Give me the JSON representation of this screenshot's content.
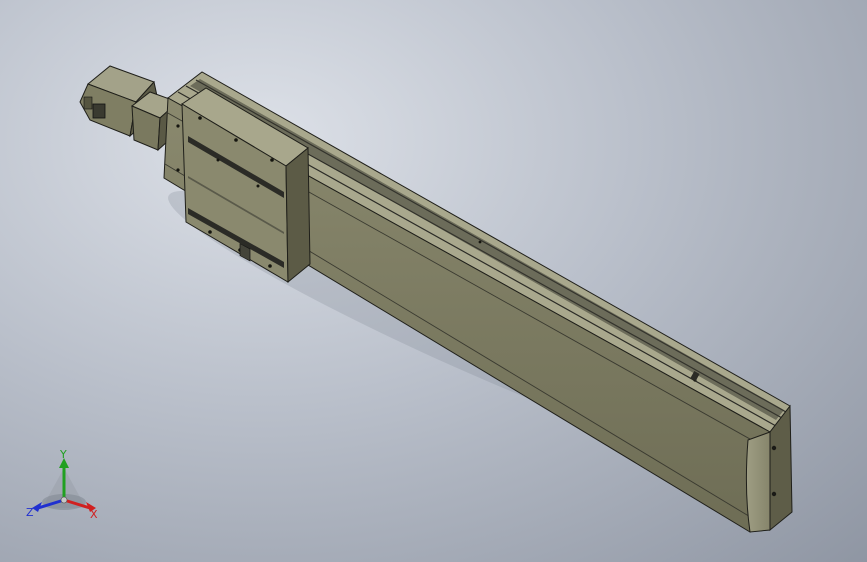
{
  "viewport": {
    "background_center": "#dde1e8",
    "background_edge": "#8f96a3"
  },
  "model": {
    "body_color": "#7d7c62",
    "body_top_color": "#a9a88d",
    "body_dark_color": "#54533f",
    "edge_color": "#1f1f1a",
    "slot_color": "#2b2b26"
  },
  "triad": {
    "x_label": "X",
    "y_label": "Y",
    "z_label": "Z",
    "x_color": "#d02020",
    "y_color": "#20a020",
    "z_color": "#2030d0"
  }
}
